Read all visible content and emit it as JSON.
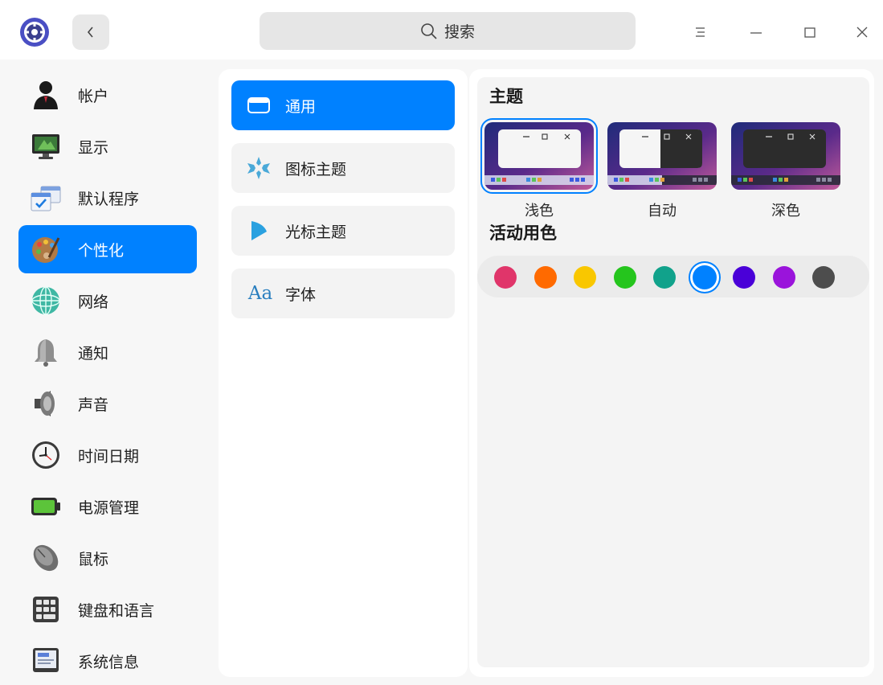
{
  "window": {
    "search_placeholder": "搜索"
  },
  "sidebar": {
    "items": [
      {
        "label": "帐户",
        "icon": "user-account-icon"
      },
      {
        "label": "显示",
        "icon": "monitor-display-icon"
      },
      {
        "label": "默认程序",
        "icon": "default-apps-icon"
      },
      {
        "label": "个性化",
        "icon": "palette-icon",
        "active": true
      },
      {
        "label": "网络",
        "icon": "network-globe-icon"
      },
      {
        "label": "通知",
        "icon": "bell-icon"
      },
      {
        "label": "声音",
        "icon": "speaker-icon"
      },
      {
        "label": "时间日期",
        "icon": "clock-icon"
      },
      {
        "label": "电源管理",
        "icon": "battery-icon"
      },
      {
        "label": "鼠标",
        "icon": "mouse-icon"
      },
      {
        "label": "键盘和语言",
        "icon": "keyboard-icon"
      },
      {
        "label": "系统信息",
        "icon": "system-info-icon"
      }
    ]
  },
  "subnav": {
    "items": [
      {
        "label": "通用",
        "icon": "window-general-icon",
        "active": true
      },
      {
        "label": "图标主题",
        "icon": "icon-theme-icon"
      },
      {
        "label": "光标主题",
        "icon": "cursor-theme-icon"
      },
      {
        "label": "字体",
        "icon": "font-aa-icon",
        "glyph": "Aa"
      }
    ]
  },
  "theme": {
    "section_title": "主题",
    "options": [
      {
        "label": "浅色",
        "selected": true
      },
      {
        "label": "自动",
        "selected": false
      },
      {
        "label": "深色",
        "selected": false
      }
    ]
  },
  "accent": {
    "section_title": "活动用色",
    "colors": [
      "#e0356a",
      "#ff6a00",
      "#f9c700",
      "#25c51d",
      "#11a28b",
      "#0081ff",
      "#4a00d8",
      "#9a14db",
      "#4d4d4d"
    ],
    "selected_index": 5
  },
  "colors": {
    "accent": "#0081ff"
  }
}
